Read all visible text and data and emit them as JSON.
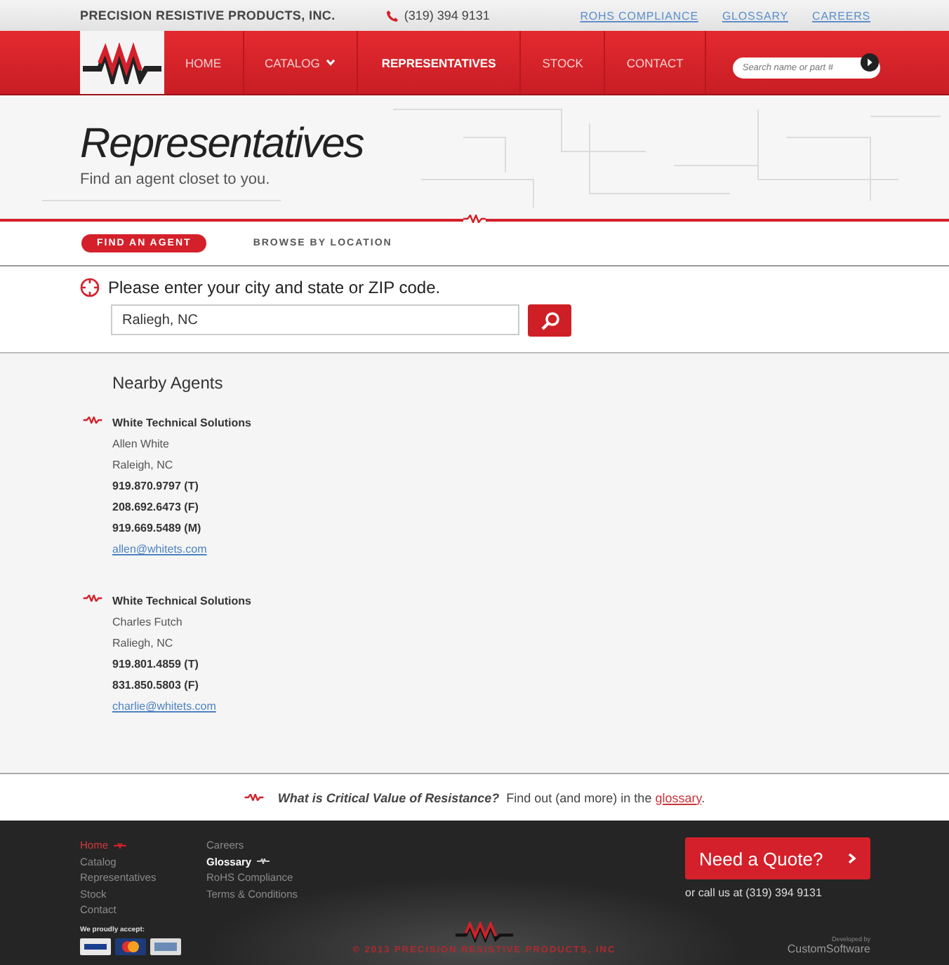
{
  "top_bar": {
    "company": "PRECISION RESISTIVE PRODUCTS, INC.",
    "phone": "(319) 394 9131",
    "links": [
      "ROHS COMPLIANCE",
      "GLOSSARY",
      "CAREERS"
    ]
  },
  "nav": {
    "items": [
      {
        "label": "HOME",
        "selected": false,
        "dropdown": false
      },
      {
        "label": "CATALOG",
        "selected": false,
        "dropdown": true
      },
      {
        "label": "REPRESENTATIVES",
        "selected": true,
        "dropdown": false
      },
      {
        "label": "STOCK",
        "selected": false,
        "dropdown": false
      },
      {
        "label": "CONTACT",
        "selected": false,
        "dropdown": false
      }
    ],
    "search_placeholder": "Search name or part #"
  },
  "hero": {
    "title": "Representatives",
    "subtitle": "Find an agent closet to you."
  },
  "tabs": [
    {
      "label": "FIND AN AGENT",
      "selected": true
    },
    {
      "label": "BROWSE BY LOCATION",
      "selected": false
    }
  ],
  "search": {
    "prompt": "Please enter your city and state or ZIP code.",
    "value": "Raliegh, NC"
  },
  "agents": {
    "heading": "Nearby Agents",
    "items": [
      {
        "company": "White Technical Solutions",
        "name": "Allen White",
        "city": "Raleigh, NC",
        "phones": [
          "919.870.9797 (T)",
          "208.692.6473 (F)",
          "919.669.5489 (M)"
        ],
        "email": "allen@whitets.com"
      },
      {
        "company": "White Technical Solutions",
        "name": "Charles Futch",
        "city": "Raliegh, NC",
        "phones": [
          "919.801.4859 (T)",
          "831.850.5803 (F)"
        ],
        "email": "charlie@whitets.com"
      }
    ]
  },
  "promo": {
    "question": "What is Critical Value of Resistance?",
    "text": "Find out (and more) in the",
    "link": "glossary",
    "end": "."
  },
  "footer": {
    "columns": [
      [
        {
          "label": "Home",
          "selected": true,
          "hovered": false
        },
        {
          "label": "Catalog",
          "selected": false,
          "hovered": false
        },
        {
          "label": "Representatives",
          "selected": false,
          "hovered": false
        },
        {
          "label": "Stock",
          "selected": false,
          "hovered": false
        },
        {
          "label": "Contact",
          "selected": false,
          "hovered": false
        }
      ],
      [
        {
          "label": "Careers",
          "selected": false,
          "hovered": false
        },
        {
          "label": "Glossary",
          "selected": false,
          "hovered": true
        },
        {
          "label": "RoHS Compliance",
          "selected": false,
          "hovered": false
        },
        {
          "label": "Terms & Conditions",
          "selected": false,
          "hovered": false
        }
      ]
    ],
    "quote_button": "Need a Quote?",
    "call_text": "or call us at (319) 394 9131",
    "accept_label": "We proudly accept:",
    "copyright": "© 2013 PRECISION RESISTIVE PRODUCTS, INC",
    "developer_label": "Developed by",
    "developer": "CustomSoftware"
  }
}
